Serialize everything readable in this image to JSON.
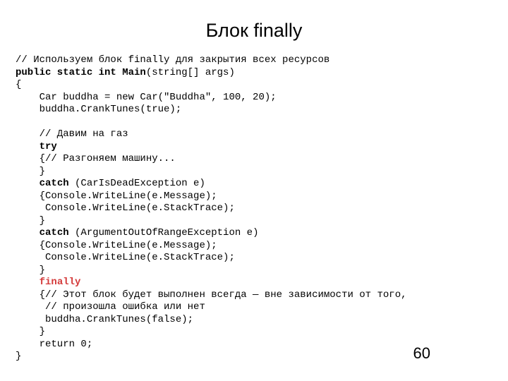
{
  "title": "Блок finally",
  "page_number": "60",
  "code": {
    "c0": "// Используем блок finally для закрытия всех ресурсов",
    "sig_kw": "public static int Main",
    "sig_rest": "(string[] args)",
    "open_brace": "{",
    "l1": "    Car buddha = new Car(\"Buddha\", 100, 20);",
    "l2": "    buddha.CrankTunes(true);",
    "blank": "",
    "c1": "    // Давим на газ",
    "try_indent": "    ",
    "try_kw": "try",
    "l3": "    {// Разгоняем машину...",
    "l4": "    }",
    "catch_indent": "    ",
    "catch_kw": "catch",
    "catch1_rest": " (CarIsDeadException e)",
    "l5": "    {Console.WriteLine(e.Message);",
    "l6": "     Console.WriteLine(e.StackTrace);",
    "l7": "    }",
    "catch2_rest": " (ArgumentOutOfRangeException e)",
    "l8": "    {Console.WriteLine(e.Message);",
    "l9": "     Console.WriteLine(e.StackTrace);",
    "l10": "    }",
    "finally_indent": "    ",
    "finally_kw": "finally",
    "l11": "    {// Этот блок будет выполнен всегда — вне зависимости от того,",
    "l12": "     // произошла ошибка или нет",
    "l13": "     buddha.CrankTunes(false);",
    "l14": "    }",
    "l15": "    return 0;",
    "close_brace": "}"
  }
}
